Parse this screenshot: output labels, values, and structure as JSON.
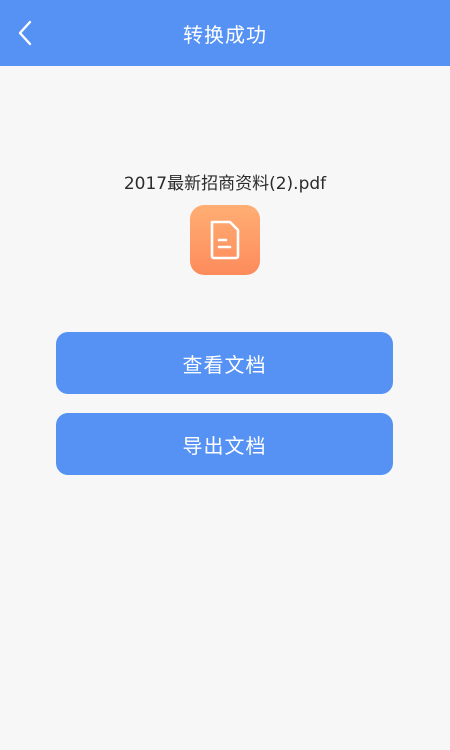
{
  "header": {
    "title": "转换成功",
    "back_icon": "chevron-left-icon"
  },
  "file": {
    "name": "2017最新招商资料(2).pdf",
    "icon": "document-icon",
    "icon_color": "#fd8b5c"
  },
  "actions": {
    "view_label": "查看文档",
    "export_label": "导出文档"
  },
  "colors": {
    "primary": "#5592f4",
    "background": "#f7f7f7"
  }
}
